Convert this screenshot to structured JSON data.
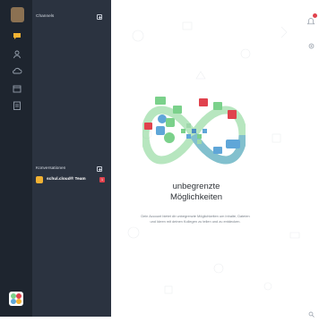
{
  "sidebar": {
    "channels_title": "Channels",
    "conversations_title": "Konversationen",
    "conversations": [
      {
        "name": "schul.cloud® Team",
        "badge": "1"
      }
    ]
  },
  "main": {
    "headline_line1": "unbegrenzte",
    "headline_line2": "Möglichkeiten",
    "description": "Dein Account bietet dir unbegrenzte Möglichkeiten um Inhalte, Dateien und Ideen mit deinen Kollegen zu teilen und zu entdecken."
  },
  "colors": {
    "rail": "#1e252f",
    "panel": "#2b3340",
    "accent_green": "#7bd18b",
    "accent_blue": "#5fa6d8",
    "badge_red": "#e0424d",
    "logo_icon": "#f2b233"
  },
  "icons": [
    "chat-icon",
    "person-icon",
    "cloud-icon",
    "calendar-icon",
    "notes-icon",
    "bell-icon",
    "settings-icon",
    "search-icon",
    "add-icon"
  ]
}
